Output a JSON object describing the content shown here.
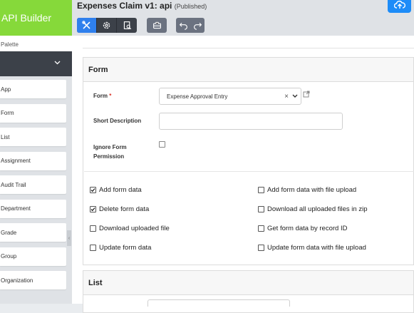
{
  "app": {
    "brand": "API Builder"
  },
  "header": {
    "title": "Expenses Claim v1: api",
    "status": "(Published)",
    "toolbar_icons": [
      "tools-icon",
      "settings-icon",
      "preview-icon",
      "toolbox-icon",
      "undo-icon",
      "redo-icon"
    ],
    "accent_color": "#2f80ed",
    "brand_color": "#86d93a"
  },
  "sidebar": {
    "palette_label": "Palette",
    "items": [
      "App",
      "Form",
      "List",
      "Assignment",
      "Audit Trail",
      "Department",
      "Grade",
      "Group",
      "Organization"
    ]
  },
  "form_section": {
    "heading": "Form",
    "form_label": "Form",
    "required_mark": "*",
    "form_value": "Expense Approval Entry",
    "clear_symbol": "×",
    "short_desc_label": "Short Description",
    "short_desc_value": "",
    "ignore_label_1": "Ignore Form",
    "ignore_label_2": "Permission",
    "ignore_checked": false,
    "options": [
      {
        "label": "Add form data",
        "checked": true
      },
      {
        "label": "Add form data with file upload",
        "checked": false
      },
      {
        "label": "Delete form data",
        "checked": true
      },
      {
        "label": "Download all uploaded files in zip",
        "checked": false
      },
      {
        "label": "Download uploaded file",
        "checked": false
      },
      {
        "label": "Get form data by record ID",
        "checked": false
      },
      {
        "label": "Update form data",
        "checked": false
      },
      {
        "label": "Update form data with file upload",
        "checked": false
      }
    ]
  },
  "list_section": {
    "heading": "List"
  }
}
